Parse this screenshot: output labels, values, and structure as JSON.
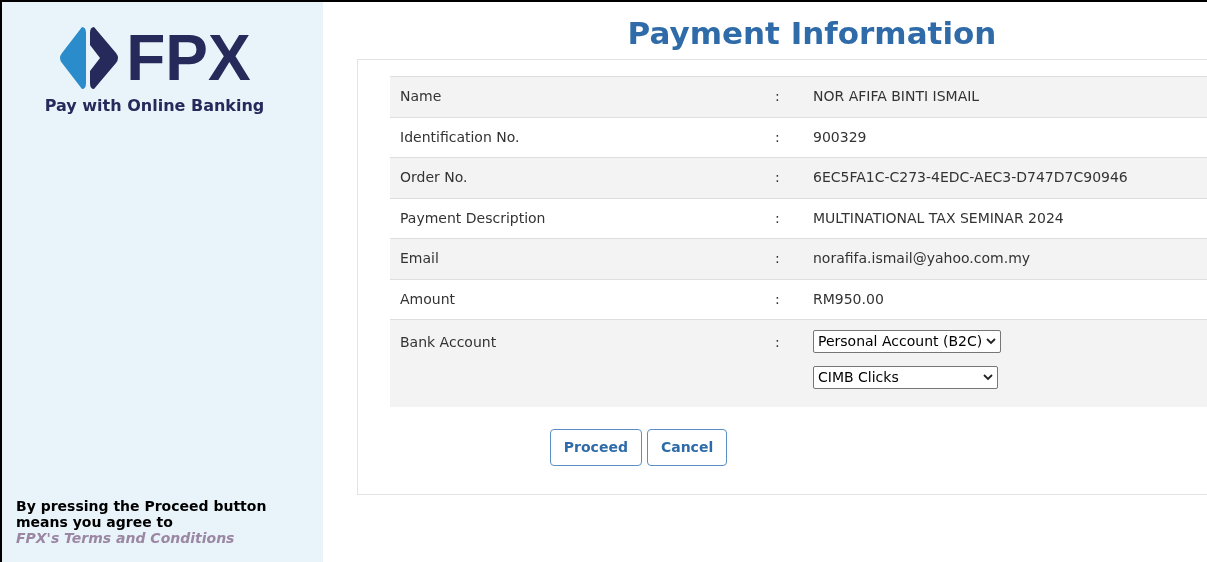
{
  "sidebar": {
    "logo_text": "FPX",
    "tagline": "Pay with Online Banking",
    "notice": "By pressing the Proceed button means you agree to",
    "terms_link": "FPX's Terms and Conditions"
  },
  "title": "Payment Information",
  "rows": [
    {
      "kind": "text",
      "label": "Name",
      "separator": ":",
      "value": "NOR AFIFA BINTI ISMAIL"
    },
    {
      "kind": "text",
      "label": "Identification No.",
      "separator": ":",
      "value": "900329"
    },
    {
      "kind": "text",
      "label": "Order No.",
      "separator": ":",
      "value": "6EC5FA1C-C273-4EDC-AEC3-D747D7C90946"
    },
    {
      "kind": "text",
      "label": "Payment Description",
      "separator": ":",
      "value": "MULTINATIONAL TAX SEMINAR 2024"
    },
    {
      "kind": "text",
      "label": "Email",
      "separator": ":",
      "value": "norafifa.ismail@yahoo.com.my"
    },
    {
      "kind": "text",
      "label": "Amount",
      "separator": ":",
      "value": "RM950.00"
    },
    {
      "kind": "selects",
      "label": "Bank Account",
      "separator": ":",
      "selects": [
        "Personal Account (B2C)",
        "CIMB Clicks"
      ]
    }
  ],
  "buttons": [
    "Proceed",
    "Cancel"
  ]
}
